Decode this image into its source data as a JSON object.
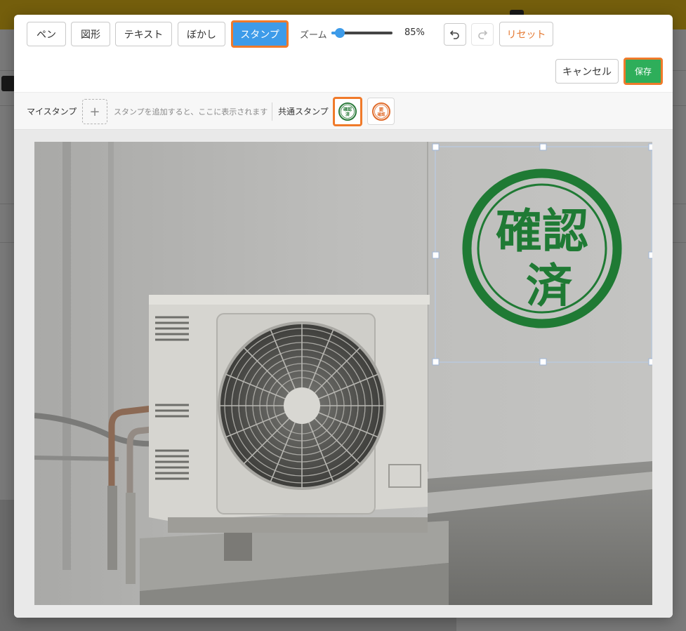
{
  "toolbar": {
    "tools": [
      "ペン",
      "図形",
      "テキスト",
      "ぼかし",
      "スタンプ"
    ],
    "active_tool": "スタンプ",
    "zoom_label": "ズーム",
    "zoom_value": "85%",
    "zoom_level": 0.85,
    "undo_icon": "undo-icon",
    "redo_icon": "redo-icon",
    "reset_label": "リセット"
  },
  "actions": {
    "cancel_label": "キャンセル",
    "save_label": "保存"
  },
  "stamp_bar": {
    "my_stamps_label": "マイスタンプ",
    "add_icon": "+",
    "hint": "スタンプを追加すると、ここに表示されます",
    "common_stamps_label": "共通スタンプ",
    "stamps": [
      {
        "text": "確認済",
        "color": "#2a7a3a"
      },
      {
        "text": "要確認",
        "color": "#e06b2a"
      }
    ]
  },
  "canvas": {
    "placed_stamp_text": "確認済",
    "stamp_color": "#1f7a34"
  },
  "colors": {
    "accent": "#3d9be9",
    "save": "#2eae5a",
    "highlight": "#f07a2a",
    "reset": "#e57a33"
  }
}
